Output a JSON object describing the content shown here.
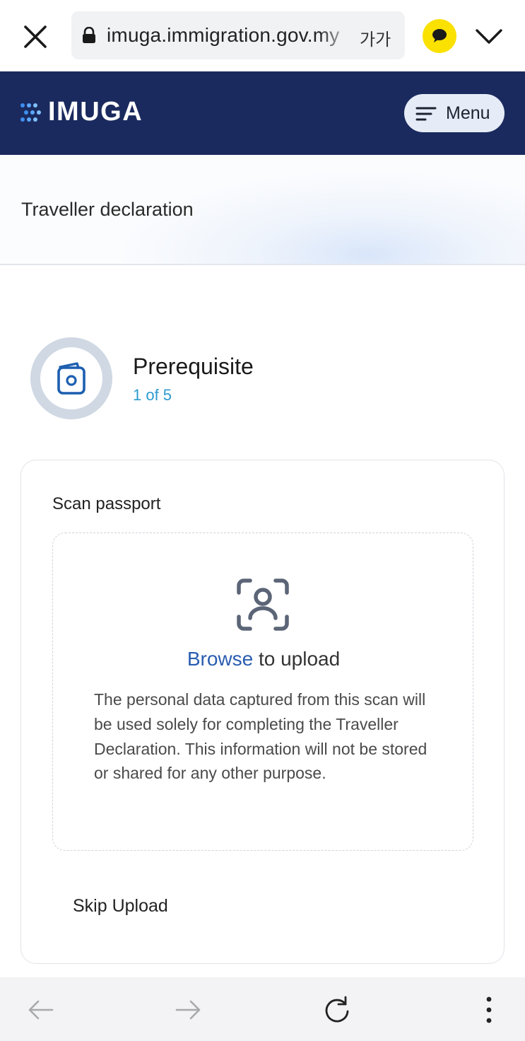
{
  "browser": {
    "url": "imuga.immigration.gov.my",
    "text_size_label": "가가",
    "talk_color": "#fae100"
  },
  "header": {
    "logo_text": "IMUGA",
    "menu_label": "Menu",
    "background": "#1a2a5e"
  },
  "page": {
    "title": "Traveller declaration"
  },
  "step": {
    "title": "Prerequisite",
    "count": "1 of 5",
    "icon": "passport-icon"
  },
  "card": {
    "label": "Scan passport",
    "browse_label": "Browse",
    "upload_suffix": " to upload",
    "privacy_text": "The personal data captured from this scan will be used solely for completing the Traveller Declaration. This information will not be stored or shared for any other purpose.",
    "skip_label": "Skip Upload"
  },
  "bottom_bar": {
    "icons": [
      "back-arrow-icon",
      "forward-arrow-icon",
      "reload-icon",
      "more-vertical-icon"
    ]
  }
}
